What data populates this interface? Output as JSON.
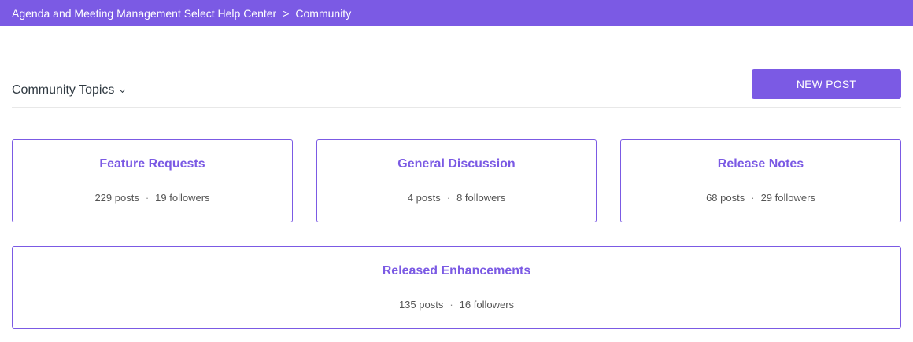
{
  "breadcrumb": {
    "home": "Agenda and Meeting Management Select Help Center",
    "separator": ">",
    "current": "Community"
  },
  "topics_header": {
    "dropdown_label": "Community Topics",
    "new_post_label": "NEW POST"
  },
  "topics": [
    {
      "title": "Feature Requests",
      "posts": "229 posts",
      "followers": "19 followers"
    },
    {
      "title": "General Discussion",
      "posts": "4 posts",
      "followers": "8 followers"
    },
    {
      "title": "Release Notes",
      "posts": "68 posts",
      "followers": "29 followers"
    },
    {
      "title": "Released Enhancements",
      "posts": "135 posts",
      "followers": "16 followers"
    }
  ],
  "colors": {
    "accent": "#7b5ae4",
    "text": "#333333",
    "divider": "#e8e8e8"
  }
}
